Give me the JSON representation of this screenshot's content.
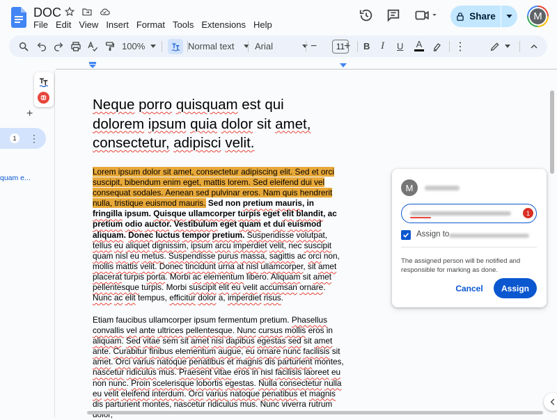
{
  "header": {
    "title": "DOC",
    "menu": [
      "File",
      "Edit",
      "View",
      "Insert",
      "Format",
      "Tools",
      "Extensions",
      "Help"
    ],
    "share_label": "Share",
    "avatar_letter": "M"
  },
  "toolbar": {
    "zoom": "100%",
    "style": "Normal text",
    "font": "Arial",
    "font_size": "11",
    "minus": "−",
    "plus": "+",
    "bold": "B",
    "italic": "I",
    "underline": "U",
    "text_color_letter": "A"
  },
  "sidebar": {
    "plus": "+",
    "outline_number": "1",
    "outline_more": "⋮",
    "outline_link": "quam e..."
  },
  "document": {
    "heading_words": [
      "Neque",
      "porro",
      "quisquam",
      "est",
      "qui",
      "dolorem",
      "ipsum",
      "quia",
      "dolor",
      "sit",
      "amet,",
      "consectetur,",
      "adipisci",
      "velit."
    ]
  },
  "comment": {
    "avatar_letter": "M",
    "badge_count": "1",
    "assign_label": "Assign to",
    "note": "The assigned person will be notified and responsible for marking as done.",
    "cancel_label": "Cancel",
    "assign_button": "Assign"
  },
  "colors": {
    "accent": "#0b57d0",
    "share_bg": "#c2e7ff",
    "highlight": "#e8a838",
    "spell_underline": "#ea4335",
    "badge": "#d93025"
  }
}
